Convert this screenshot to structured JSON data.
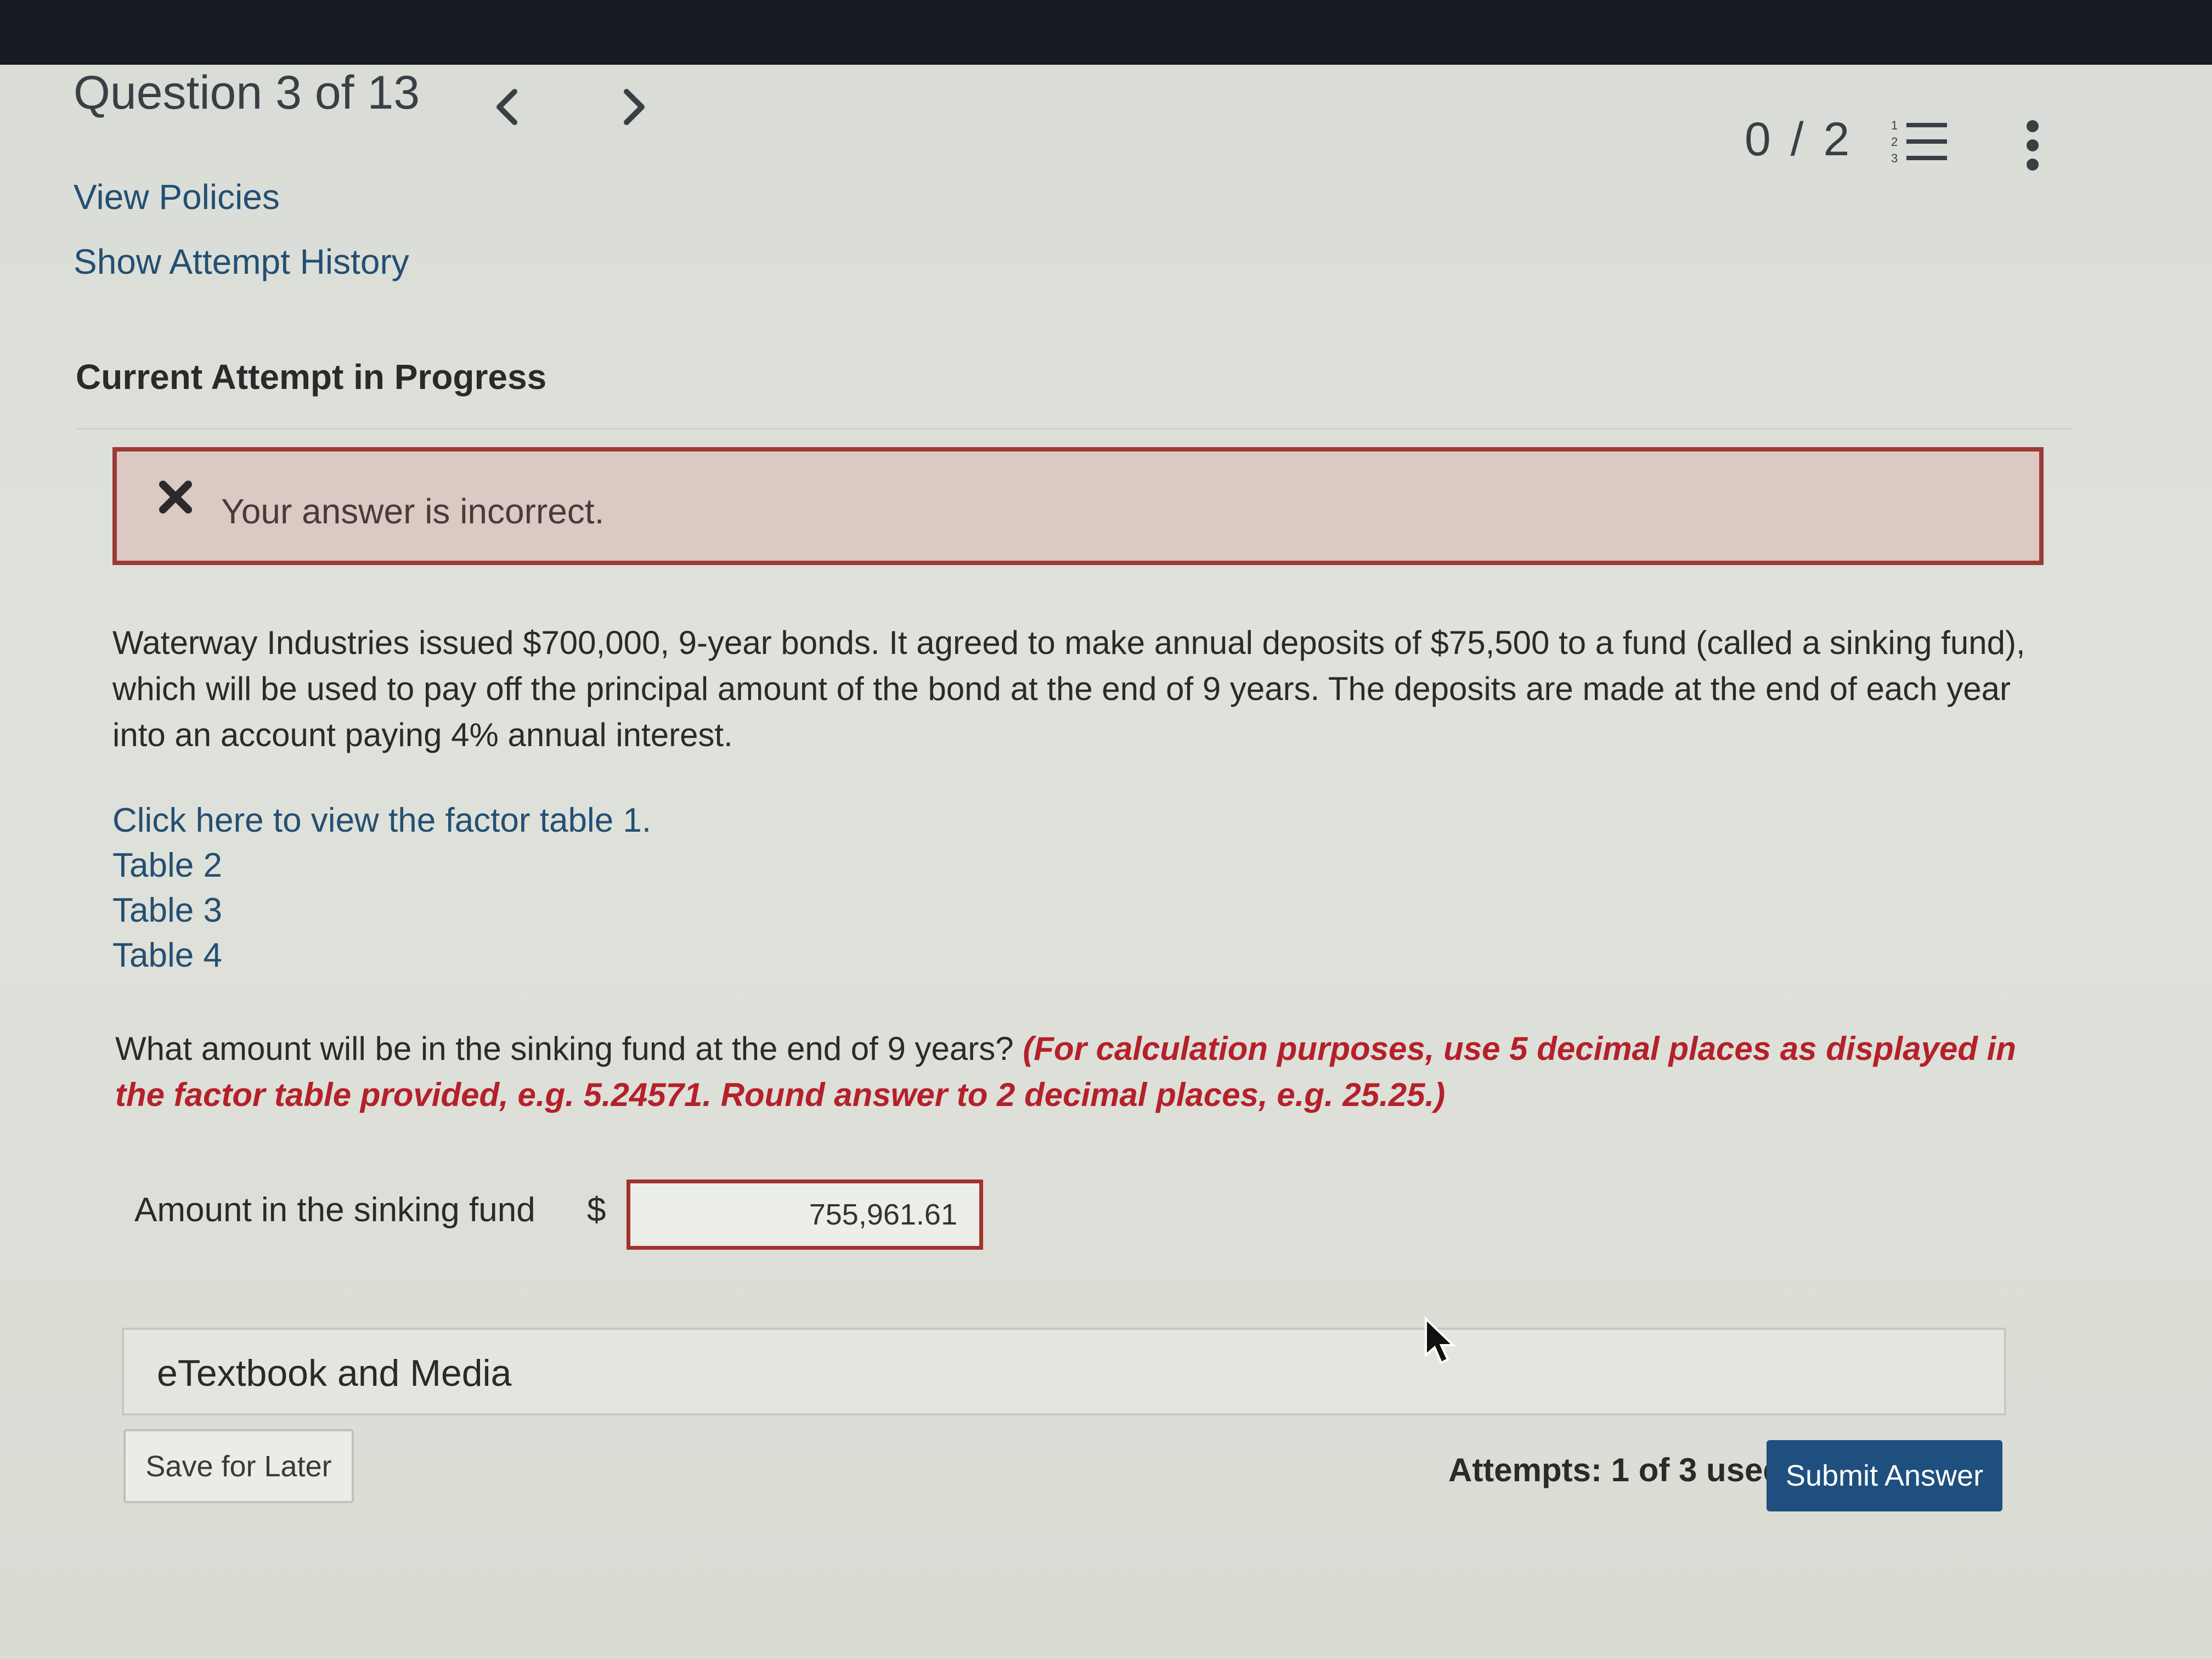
{
  "header": {
    "question_title": "Question 3 of 13",
    "prev_icon": "chevron-left-icon",
    "next_icon": "chevron-right-icon",
    "score": "0 / 2",
    "list_icon": "numbered-list-icon",
    "more_icon": "more-vertical-icon"
  },
  "links": {
    "view_policies": "View Policies",
    "attempt_history": "Show Attempt History"
  },
  "current_attempt_label": "Current Attempt in Progress",
  "alert": {
    "icon": "close-x-icon",
    "message": "Your answer is incorrect.",
    "border_color": "#9d3a36",
    "background": "#dcc9c4"
  },
  "problem_text": "Waterway Industries issued $700,000, 9-year bonds. It agreed to make annual deposits of $75,500 to a fund (called a sinking fund), which will be used to pay off the principal amount of the bond at the end of 9 years. The deposits are made at the end of each year into an account paying 4% annual interest.",
  "tables": [
    "Click here to view the factor table 1.",
    "Table 2",
    "Table 3",
    "Table 4"
  ],
  "question": {
    "text": "What amount will be in the sinking fund at the end of 9 years? ",
    "hint": "(For calculation purposes, use 5 decimal places as displayed in the factor table provided, e.g. 5.24571. Round answer to 2 decimal places, e.g. 25.25.)",
    "hint_color": "#b5202a"
  },
  "answer": {
    "label": "Amount in the sinking fund",
    "currency": "$",
    "value": "755,961.61"
  },
  "etextbook_label": "eTextbook and Media",
  "footer": {
    "save_label": "Save for Later",
    "attempts": "Attempts: 1 of 3 used",
    "submit_label": "Submit Answer",
    "submit_color": "#1f4f7e"
  }
}
